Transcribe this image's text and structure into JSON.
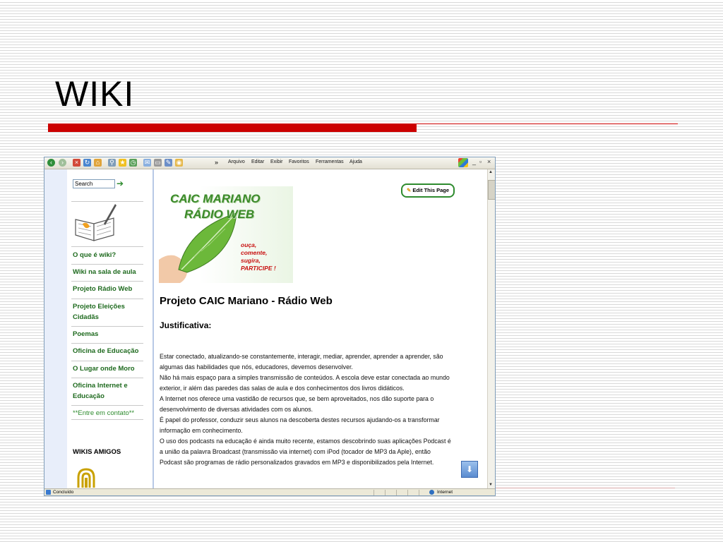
{
  "slide": {
    "title": "WIKI"
  },
  "browser": {
    "menu": [
      "Arquivo",
      "Editar",
      "Exibir",
      "Favoritos",
      "Ferramentas",
      "Ajuda"
    ],
    "toolbar_icons": [
      "back-icon",
      "forward-icon",
      "stop-icon",
      "refresh-icon",
      "home-icon",
      "search-icon",
      "favorites-icon",
      "history-icon",
      "mail-icon",
      "print-icon",
      "edit-icon",
      "messenger-icon"
    ],
    "window_controls": {
      "minimize": "_",
      "restore": "▫",
      "close": "×"
    },
    "status": {
      "left": "Concluído",
      "right": "Internet"
    }
  },
  "sidebar": {
    "search_placeholder": "Search",
    "nav": [
      {
        "label": "O que é wiki?",
        "light": false
      },
      {
        "label": "Wiki na sala de aula",
        "light": false
      },
      {
        "label": "Projeto Rádio Web",
        "light": false
      },
      {
        "label": "Projeto Eleições Cidadãs",
        "light": false
      },
      {
        "label": "Poemas",
        "light": false
      },
      {
        "label": "Oficina de Educação",
        "light": false
      },
      {
        "label": "O Lugar onde Moro",
        "light": false
      },
      {
        "label": "Oficina Internet e Educação",
        "light": false
      },
      {
        "label": "**Entre em contato**",
        "light": true
      }
    ],
    "wikis_heading": "WIKIS AMIGOS"
  },
  "content": {
    "edit_button": "Edit This Page",
    "banner": {
      "line1": "CAIC MARIANO",
      "line2": "RÁDIO WEB",
      "slogan": [
        "ouça,",
        "comente,",
        "sugira,",
        "PARTICIPE !"
      ]
    },
    "heading": "Projeto CAIC Mariano - Rádio Web",
    "section": "Justificativa:",
    "paragraphs": [
      "Estar conectado, atualizando-se constantemente, interagir, mediar, aprender, aprender a aprender, são algumas das habilidades que nós, educadores, devemos desenvolver.",
      "Não há mais espaço para a simples transmissão de conteúdos. A escola deve estar conectada ao mundo exterior, ir além das paredes das salas de aula e dos conhecimentos dos livros didáticos.",
      "A Internet nos oferece uma vastidão de recursos que, se bem aproveitados, nos dão suporte para o desenvolvimento de diversas atividades com os alunos.",
      "É papel do professor, conduzir seus alunos na descoberta destes recursos ajudando-os a transformar informação em conhecimento.",
      "O uso dos podcasts na educação é ainda muito recente, estamos descobrindo suas aplicações Podcast é a união da palavra Broadcast (transmissão via internet) com iPod (tocador de MP3 da Aple), então Podcast são programas de rádio personalizados gravados em MP3 e disponibilizados pela Internet."
    ]
  },
  "colors": {
    "accent_red": "#cc0000",
    "link_green": "#1e6a1e",
    "banner_green": "#3c8a2a",
    "slogan_red": "#c81010"
  }
}
